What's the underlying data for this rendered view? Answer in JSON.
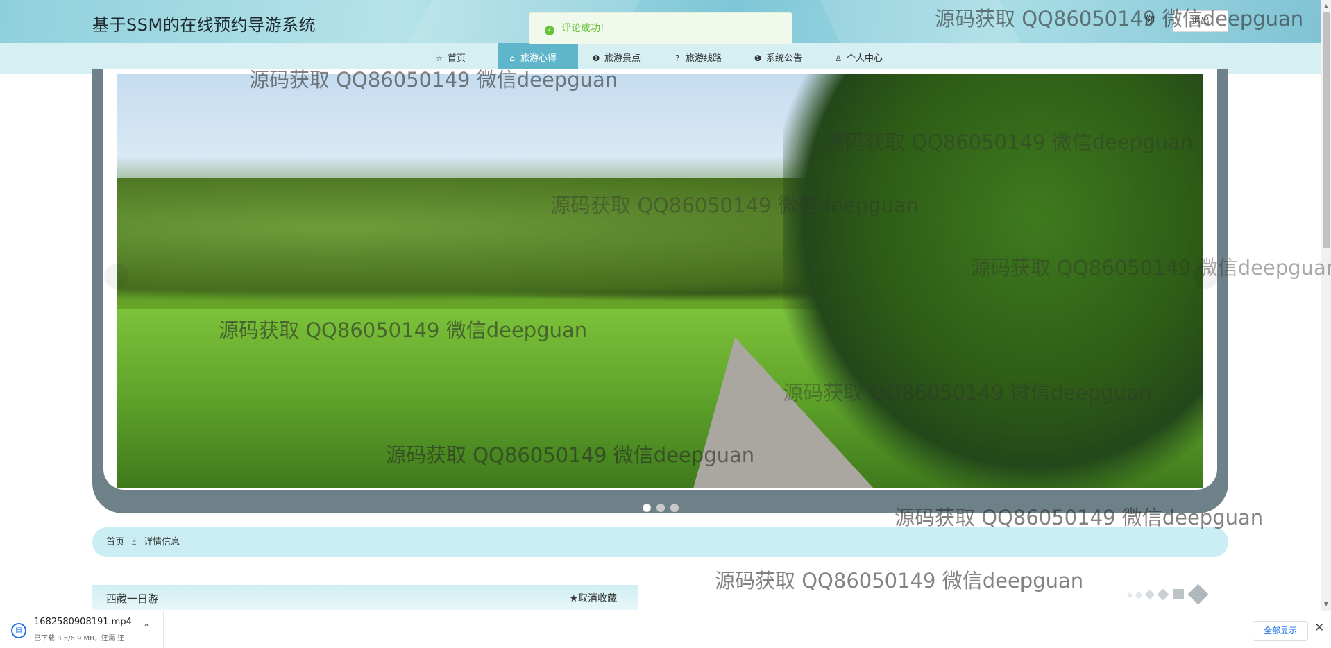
{
  "header": {
    "site_title": "基于SSM的在线预约导游系统",
    "logout_label": "退出",
    "user_text": "你"
  },
  "nav": [
    {
      "label": "首页",
      "icon": "star-icon",
      "glyph": "☆",
      "active": false
    },
    {
      "label": "旅游心得",
      "icon": "home-icon",
      "glyph": "⌂",
      "active": true
    },
    {
      "label": "旅游景点",
      "icon": "info-icon",
      "glyph": "❶",
      "active": false
    },
    {
      "label": "旅游线路",
      "icon": "question-icon",
      "glyph": "?",
      "active": false
    },
    {
      "label": "系统公告",
      "icon": "info-icon",
      "glyph": "❶",
      "active": false
    },
    {
      "label": "个人中心",
      "icon": "user-icon",
      "glyph": "♙",
      "active": false
    }
  ],
  "toast": {
    "message": "评论成功!",
    "icon": "success-check-icon"
  },
  "carousel": {
    "slides": 3,
    "active_index": 0
  },
  "breadcrumb": {
    "home": "首页",
    "separator": "Ξ",
    "current": "详情信息"
  },
  "detail": {
    "title": "西藏一日游",
    "favorite_label": "★取消收藏"
  },
  "watermark": "源码获取 QQ86050149 微信deepguan",
  "download": {
    "file_name": "1682580908191.mp4",
    "status": "已下载 3.5/6.9 MB，还需 还...",
    "show_all": "全部显示",
    "close": "✕"
  }
}
